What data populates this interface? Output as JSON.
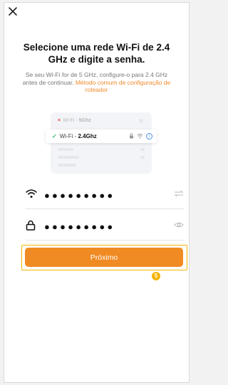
{
  "header": {
    "close_icon": "close-icon"
  },
  "title": "Selecione uma rede Wi-Fi de 2.4 GHz e digite a senha.",
  "subtitle": {
    "text": "Se seu Wi-Fi for de 5 GHz, configure-o para 2.4 GHz antes de continuar. ",
    "link": "Método comum de configuração de roteador"
  },
  "illustration": {
    "row_5ghz_prefix": "Wi-Fi - ",
    "row_5ghz_band": "5Ghz",
    "row_24ghz_prefix": "Wi-Fi - ",
    "row_24ghz_band": "2.4Ghz",
    "x_mark": "×",
    "check_mark": "✓",
    "lock_glyph": "🔒",
    "wifi_glyph": "ᯤ",
    "info_glyph": "i"
  },
  "wifi_field": {
    "value": "●●●●●●●●●",
    "lead_icon": "wifi-icon",
    "trail_icon": "swap-icon"
  },
  "password_field": {
    "value": "●●●●●●●●●",
    "lead_icon": "lock-icon",
    "trail_icon": "eye-icon"
  },
  "next_button": {
    "label": "Próximo"
  },
  "step_badge": "5",
  "colors": {
    "accent": "#f08a22",
    "highlight": "#f5b400",
    "link": "#f0892b"
  }
}
